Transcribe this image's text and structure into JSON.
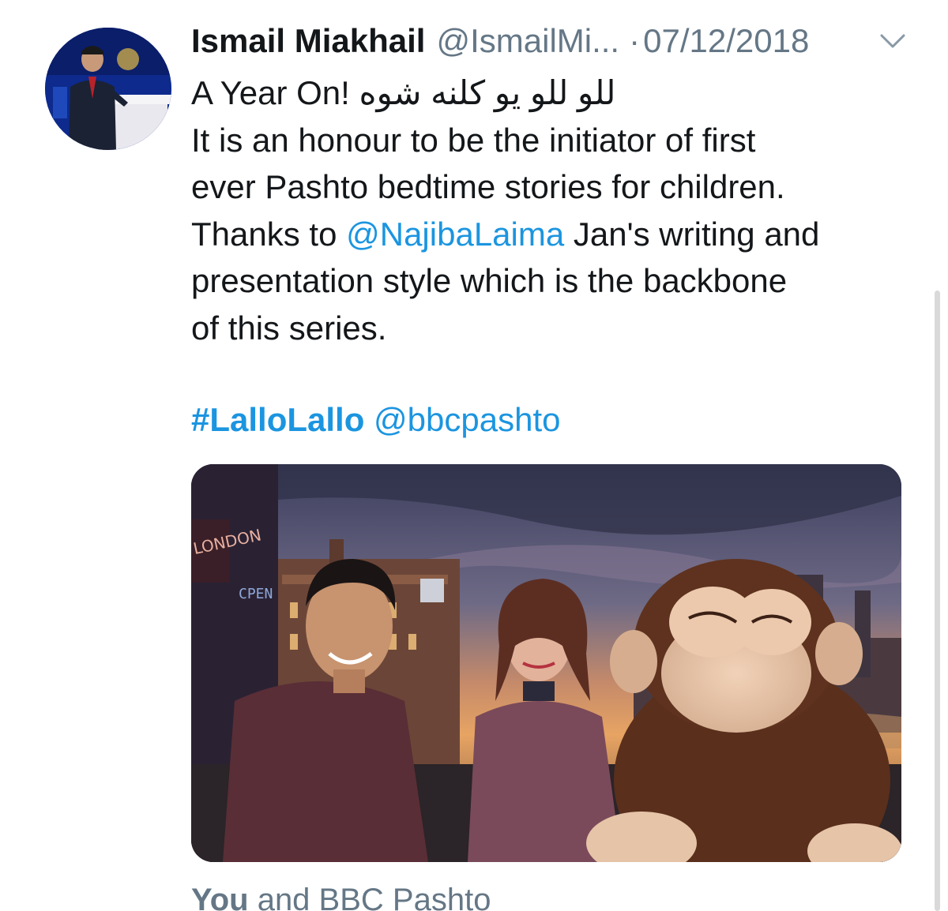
{
  "tweet": {
    "author_name": "Ismail Miakhail",
    "author_handle": "@IsmailMi...",
    "separator": "·",
    "date": "07/12/2018",
    "lines": {
      "l1_prefix": "A Year On! ",
      "l1_pashto": "للو للو یو کلنه شوه",
      "l2": "It is an honour to be the initiator of first",
      "l3": "ever Pashto bedtime stories for children.",
      "l4_before": "Thanks to ",
      "l4_mention": "@NajibaLaima",
      "l4_after": " Jan's writing and",
      "l5": "presentation style which is the backbone",
      "l6": "of this series."
    },
    "hashtag": "#LalloLallo",
    "hashtag_mention": "@bbcpashto",
    "media_sign_text": "LONDON",
    "media_sign_text2": "CPEN"
  },
  "footer": {
    "you": "You",
    "rest": " and BBC Pashto"
  },
  "icons": {
    "more": "chevron-down-icon"
  },
  "colors": {
    "link": "#1b95e0",
    "secondary_text": "#657786",
    "primary_text": "#14171a"
  }
}
